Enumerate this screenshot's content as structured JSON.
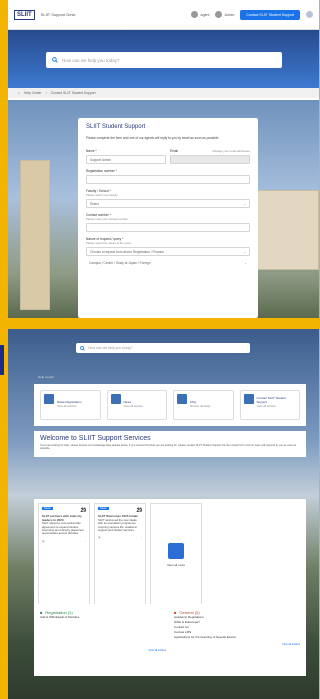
{
  "colors": {
    "brand": "#2a3a7a",
    "accent": "#1a73e8",
    "border": "#f3b400"
  },
  "frame1": {
    "header": {
      "logo": "SLIIT",
      "site_title": "SLIIT Support Desk",
      "nav_1": "Agent",
      "nav_2": "Admin",
      "cta_button": "Contact SLIIT Student Support"
    },
    "search_placeholder": "How can we help you today?",
    "breadcrumb": {
      "home": "Help Center",
      "current": "Contact SLIIT Student Support"
    },
    "form": {
      "title": "SLIIT Student Support",
      "description": "Please complete the form and one of our agents will reply to you by email as soon as possible.",
      "name_label": "Name *",
      "name_value": "Support Admin",
      "email_label": "Email",
      "email_hint": "Manage your email addresses",
      "reg_label": "Registration number *",
      "faculty_label": "Faculty / School *",
      "faculty_hint": "Please select your faculty",
      "faculty_value": "Select",
      "contact_label": "Contact number *",
      "contact_hint": "Please enter your contact number",
      "request_label": "Nature of request / query *",
      "request_hint": "Please select the nature of the query",
      "request_value": "Choose a request from above Registration / Finance",
      "campus_value": "Campus / Center / Study at Japan / Foreign"
    }
  },
  "frame2": {
    "search_placeholder": "How can we help you today?",
    "breadcrumb": "Help Center",
    "tiles": [
      {
        "title": "Raise Registration",
        "sub": "View all articles"
      },
      {
        "title": "News",
        "sub": "View all articles"
      },
      {
        "title": "FAQ",
        "sub": "Browse all FAQs"
      },
      {
        "title": "Contact SLIIT Student Support",
        "sub": "View all articles"
      }
    ],
    "welcome": {
      "title": "Welcome to SLIIT Support Services",
      "text": "If you are looking for help, please browse our knowledge base articles below. If you cannot find what you are looking for, please contact SLIIT Student Support via the contact form and our team will respond to you as soon as possible."
    },
    "cards": [
      {
        "badge": "News",
        "month": "JUL",
        "day": "29",
        "title": "SLIIT partners with industry leaders in 2023",
        "body": "SLIIT signed a new partnership agreement to expand student internship and industry placement opportunities across faculties."
      },
      {
        "badge": "News",
        "month": "JUL",
        "day": "29",
        "title": "SLIIT Welcomes 2023 Intake",
        "body": "SLIIT welcomed the new intake with an orientation programme covering campus life, academic support and student services."
      }
    ],
    "empty_card_label": "View all news",
    "registration": {
      "title": "Registration (1)",
      "items": [
        "Add & Withdrawal of Modules"
      ],
      "more": "View all articles"
    },
    "general": {
      "title": "General (5)",
      "items": [
        "Academic Regulations",
        "What is Eduscope?",
        "Contact Us",
        "Canvas LMS",
        "Applications for the Granting of Special Exams"
      ],
      "more": "View all articles"
    }
  }
}
